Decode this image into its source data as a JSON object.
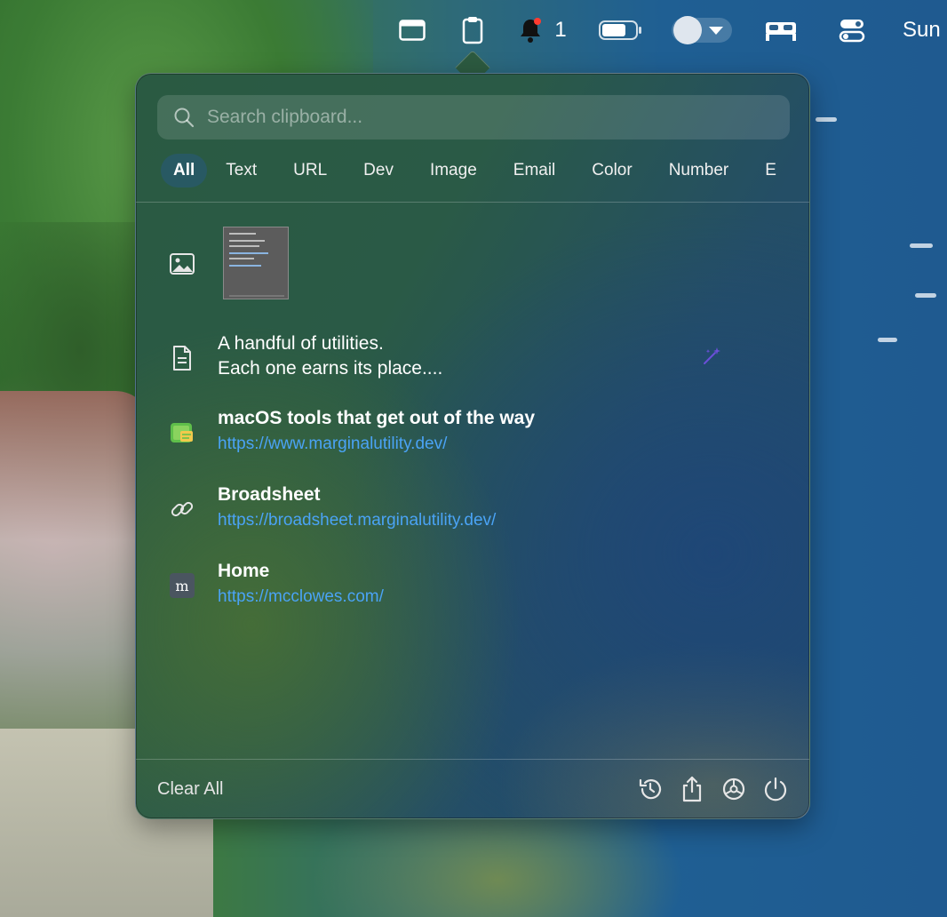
{
  "menubar": {
    "notification_count": "1",
    "clock": "Sun",
    "icons": [
      "window-icon",
      "clipboard-icon",
      "bell-icon",
      "battery-icon",
      "user-avatar-icon",
      "bed-icon",
      "control-center-icon"
    ]
  },
  "search": {
    "placeholder": "Search clipboard..."
  },
  "tabs": [
    "All",
    "Text",
    "URL",
    "Dev",
    "Image",
    "Email",
    "Color",
    "Number",
    "E"
  ],
  "active_tab": "All",
  "items": [
    {
      "type": "image",
      "icon": "image-icon"
    },
    {
      "type": "text",
      "icon": "document-icon",
      "line1": "A handful of utilities.",
      "line2": "Each one earns its place....",
      "action_icon": "magic-wand-icon"
    },
    {
      "type": "url",
      "icon": "app-icon",
      "title": "macOS tools that get out of the way",
      "url": "https://www.marginalutility.dev/"
    },
    {
      "type": "url",
      "icon": "link-icon",
      "title": "Broadsheet",
      "url": "https://broadsheet.marginalutility.dev/"
    },
    {
      "type": "url",
      "icon": "favicon-m-icon",
      "title": "Home",
      "url": "https://mcclowes.com/"
    }
  ],
  "footer": {
    "clear_all": "Clear All",
    "icons": [
      "history-icon",
      "share-icon",
      "settings-icon",
      "power-icon"
    ]
  },
  "colors": {
    "link": "#4aa3f5",
    "tab_active_bg": "#285a6e",
    "notification_dot": "#ff3b30"
  }
}
